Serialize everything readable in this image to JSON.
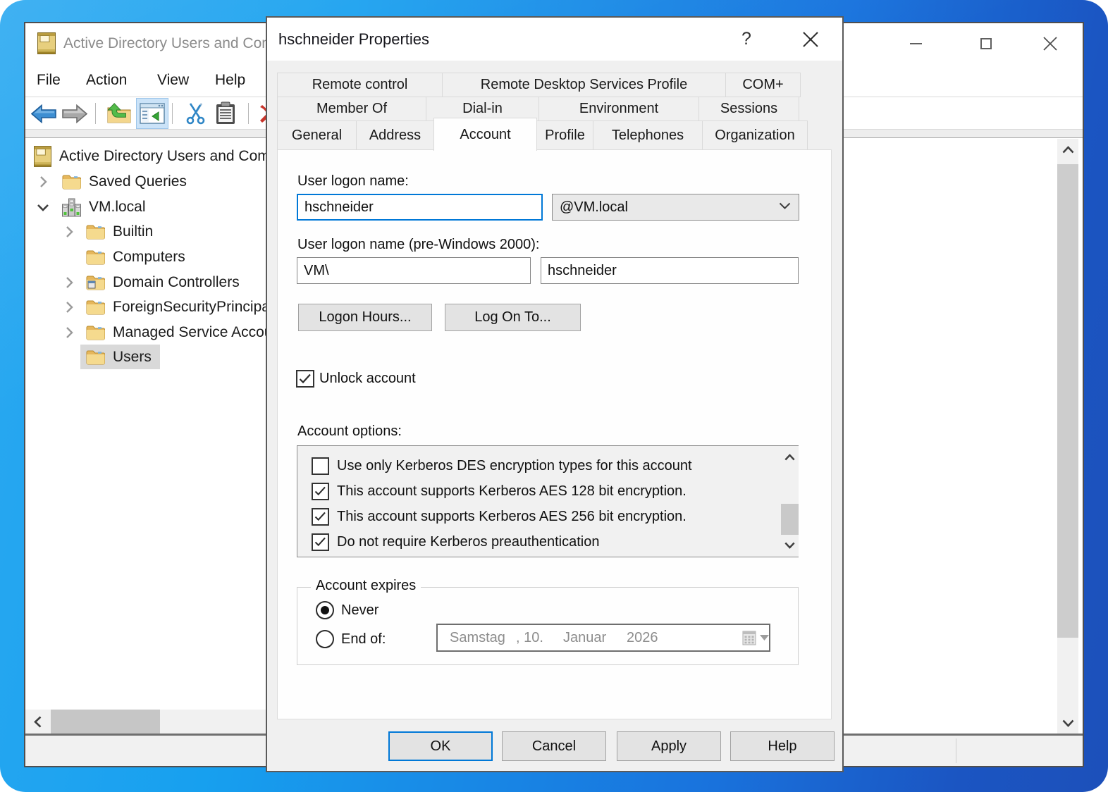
{
  "desktop": {
    "background_gradient": [
      "#2ba9f1",
      "#1c50ba"
    ]
  },
  "main_window": {
    "title": "Active Directory Users and Computers",
    "title_icon": "console-window-icon",
    "window_controls": [
      "minimize",
      "maximize",
      "close"
    ],
    "menu_items": [
      "File",
      "Action",
      "View",
      "Help"
    ],
    "toolbar_icons": [
      "back-arrow",
      "forward-arrow",
      "up-one-level-folder",
      "show-console-tree-toggled",
      "cut-scissors",
      "paste-clipboard",
      "delete-red-x"
    ],
    "tree": {
      "items": [
        {
          "label": "Active Directory Users and Computers",
          "level": 0,
          "icon": "console-root",
          "expander": "none",
          "selected": false
        },
        {
          "label": "Saved Queries",
          "level": 1,
          "icon": "folder",
          "expander": "collapsed",
          "selected": false
        },
        {
          "label": "VM.local",
          "level": 1,
          "icon": "domain",
          "expander": "expanded",
          "selected": false
        },
        {
          "label": "Builtin",
          "level": 2,
          "icon": "folder",
          "expander": "collapsed",
          "selected": false
        },
        {
          "label": "Computers",
          "level": 2,
          "icon": "folder",
          "expander": "none",
          "selected": false
        },
        {
          "label": "Domain Controllers",
          "level": 2,
          "icon": "folder-dc",
          "expander": "collapsed",
          "selected": false
        },
        {
          "label": "ForeignSecurityPrincipals",
          "level": 2,
          "icon": "folder",
          "expander": "collapsed",
          "selected": false
        },
        {
          "label": "Managed Service Accounts",
          "level": 2,
          "icon": "folder",
          "expander": "collapsed",
          "selected": false
        },
        {
          "label": "Users",
          "level": 2,
          "icon": "folder",
          "expander": "none",
          "selected": true
        }
      ]
    },
    "scrollbars": {
      "vertical": true,
      "horizontal": true
    },
    "status_bar": {
      "text": ""
    }
  },
  "dialog": {
    "title": "hschneider Properties",
    "titlebar_buttons": [
      "help",
      "close"
    ],
    "help_glyph": "?",
    "close_glyph": "✕",
    "tab_rows": [
      [
        "Remote control",
        "Remote Desktop Services Profile",
        "COM+"
      ],
      [
        "Member Of",
        "Dial-in",
        "Environment",
        "Sessions"
      ],
      [
        "General",
        "Address",
        "Account",
        "Profile",
        "Telephones",
        "Organization"
      ]
    ],
    "active_tab": "Account",
    "account_tab": {
      "user_logon_name_label": "User logon name:",
      "user_logon_name_value": "hschneider",
      "domain_suffix_value": "@VM.local",
      "pre_windows_2000_label": "User logon name (pre-Windows 2000):",
      "pre_windows_2000_domain": "VM\\",
      "pre_windows_2000_name": "hschneider",
      "logon_hours_button": "Logon Hours...",
      "log_on_to_button": "Log On To...",
      "unlock_account_label": "Unlock account",
      "unlock_account_checked": true,
      "account_options_label": "Account options:",
      "account_options": [
        {
          "label": "Use only Kerberos DES encryption types for this account",
          "checked": false
        },
        {
          "label": "This account supports Kerberos AES 128 bit encryption.",
          "checked": true
        },
        {
          "label": "This account supports Kerberos AES 256 bit encryption.",
          "checked": true
        },
        {
          "label": "Do not require Kerberos preauthentication",
          "checked": true
        }
      ],
      "account_expires_group_label": "Account expires",
      "expires_options": [
        {
          "label": "Never",
          "selected": true
        },
        {
          "label": "End of:",
          "selected": false
        }
      ],
      "expire_date_parts": [
        "Samstag",
        ", 10.",
        "Januar",
        "2026"
      ],
      "expire_date_disabled": true
    },
    "footer_buttons": [
      "OK",
      "Cancel",
      "Apply",
      "Help"
    ],
    "default_button": "OK",
    "accent_color": "#0078d7"
  }
}
